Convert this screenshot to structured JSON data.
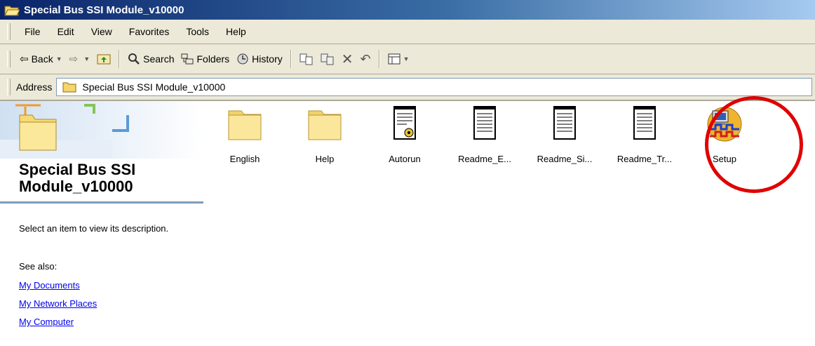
{
  "window": {
    "title": "Special Bus SSI Module_v10000",
    "title_icon": "folder-open-icon"
  },
  "menu": [
    "File",
    "Edit",
    "View",
    "Favorites",
    "Tools",
    "Help"
  ],
  "toolbar": {
    "back": "Back",
    "forward_icon": "forward-arrow-icon",
    "up_icon": "up-folder-icon",
    "search": "Search",
    "folders": "Folders",
    "history": "History",
    "move_icon": "move-to-icon",
    "copy_icon": "copy-to-icon",
    "delete_icon": "delete-icon",
    "undo_icon": "undo-icon",
    "views_icon": "views-icon"
  },
  "address": {
    "label": "Address",
    "value": "Special Bus SSI Module_v10000"
  },
  "left_pane": {
    "folder_title": "Special Bus SSI Module_v10000",
    "description": "Select an item to view its description.",
    "see_also": "See also:",
    "links": [
      "My Documents",
      "My Network Places",
      "My Computer"
    ]
  },
  "files": [
    {
      "name": "English",
      "type": "folder"
    },
    {
      "name": "Help",
      "type": "folder"
    },
    {
      "name": "Autorun",
      "type": "settings-file"
    },
    {
      "name": "Readme_E...",
      "type": "text-file"
    },
    {
      "name": "Readme_Si...",
      "type": "text-file"
    },
    {
      "name": "Readme_Tr...",
      "type": "text-file"
    },
    {
      "name": "Setup",
      "type": "setup-app"
    }
  ],
  "colors": {
    "highlight": "#e00000",
    "titlebar": "#0a246a",
    "chrome": "#ece9d8",
    "link": "#0000ee"
  }
}
